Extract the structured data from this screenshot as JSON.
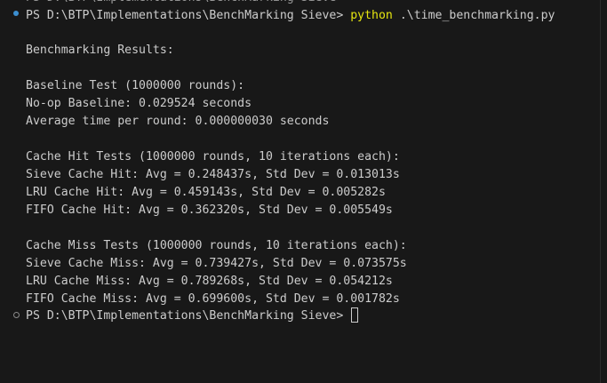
{
  "terminal": {
    "partial_line": "PS D:\\BTP\\Implementations\\BenchMarking Sieve>",
    "prompt1": {
      "prefix": "PS D:\\BTP\\Implementations\\BenchMarking Sieve> ",
      "command": "python",
      "args": " .\\time_benchmarking.py"
    },
    "lines": [
      "Benchmarking Results:",
      "",
      "Baseline Test (1000000 rounds):",
      "No-op Baseline: 0.029524 seconds",
      "Average time per round: 0.000000030 seconds",
      "",
      "Cache Hit Tests (1000000 rounds, 10 iterations each):",
      "Sieve Cache Hit: Avg = 0.248437s, Std Dev = 0.013013s",
      "LRU Cache Hit: Avg = 0.459143s, Std Dev = 0.005282s",
      "FIFO Cache Hit: Avg = 0.362320s, Std Dev = 0.005549s",
      "",
      "Cache Miss Tests (1000000 rounds, 10 iterations each):",
      "Sieve Cache Miss: Avg = 0.739427s, Std Dev = 0.073575s",
      "LRU Cache Miss: Avg = 0.789268s, Std Dev = 0.054212s",
      "FIFO Cache Miss: Avg = 0.699600s, Std Dev = 0.001782s"
    ],
    "prompt2": {
      "prefix": "PS D:\\BTP\\Implementations\\BenchMarking Sieve> "
    },
    "colors": {
      "background": "#181818",
      "text": "#cccccc",
      "command": "#e5e510",
      "success_marker": "#3c8fd0"
    }
  }
}
